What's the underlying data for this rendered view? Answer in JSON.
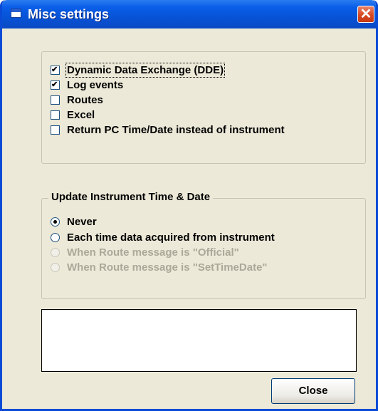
{
  "window": {
    "title": "Misc settings",
    "close_glyph": "✕"
  },
  "options": [
    {
      "label": "Dynamic Data Exchange (DDE)",
      "checked": true
    },
    {
      "label": "Log events",
      "checked": true
    },
    {
      "label": "Routes",
      "checked": false
    },
    {
      "label": "Excel",
      "checked": false
    },
    {
      "label": "Return PC Time/Date instead of instrument",
      "checked": false
    }
  ],
  "update_group": {
    "title": "Update Instrument Time & Date",
    "options": [
      {
        "label": "Never",
        "selected": true,
        "enabled": true
      },
      {
        "label": "Each time data acquired from instrument",
        "selected": false,
        "enabled": true
      },
      {
        "label": "When Route message is \"Official\"",
        "selected": false,
        "enabled": false
      },
      {
        "label": "When Route message is \"SetTimeDate\"",
        "selected": false,
        "enabled": false
      }
    ]
  },
  "message_box": {
    "value": ""
  },
  "close_button": {
    "label": "Close"
  },
  "colors": {
    "titlebar": "#0753d6",
    "window_bg": "#ece9d8",
    "close_red": "#d6451f"
  }
}
